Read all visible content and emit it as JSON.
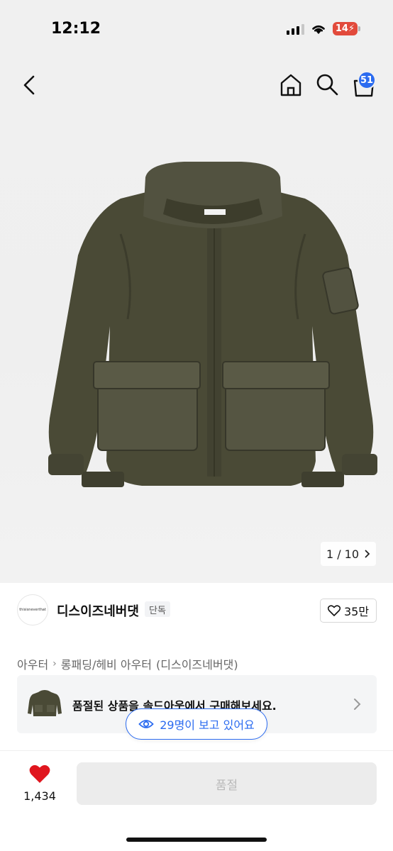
{
  "status_bar": {
    "time": "12:12",
    "battery": "14"
  },
  "nav": {
    "cart_count": "51"
  },
  "gallery": {
    "counter": "1 / 10"
  },
  "brand": {
    "logo_text": "thisisneverthat",
    "name": "디스이즈네버댓",
    "tag": "단독",
    "likes": "35만"
  },
  "breadcrumb": {
    "level1": "아우터",
    "level2": "롱패딩/헤비 아우터",
    "brand": "(디스이즈네버댓)"
  },
  "soldout": {
    "text": "품절된 상품을 솔드아웃에서 구매해보세요."
  },
  "viewers": {
    "text": "29명이 보고 있어요"
  },
  "bottom": {
    "wish_count": "1,434",
    "buy_label": "품절"
  },
  "colors": {
    "accent_blue": "#2b6bf0",
    "heart_red": "#e0161e",
    "jacket": "#4a4a36"
  },
  "icons": [
    "back-icon",
    "home-icon",
    "search-icon",
    "cart-icon",
    "heart-outline-icon",
    "eye-icon",
    "chevron-right-icon",
    "heart-filled-icon"
  ]
}
